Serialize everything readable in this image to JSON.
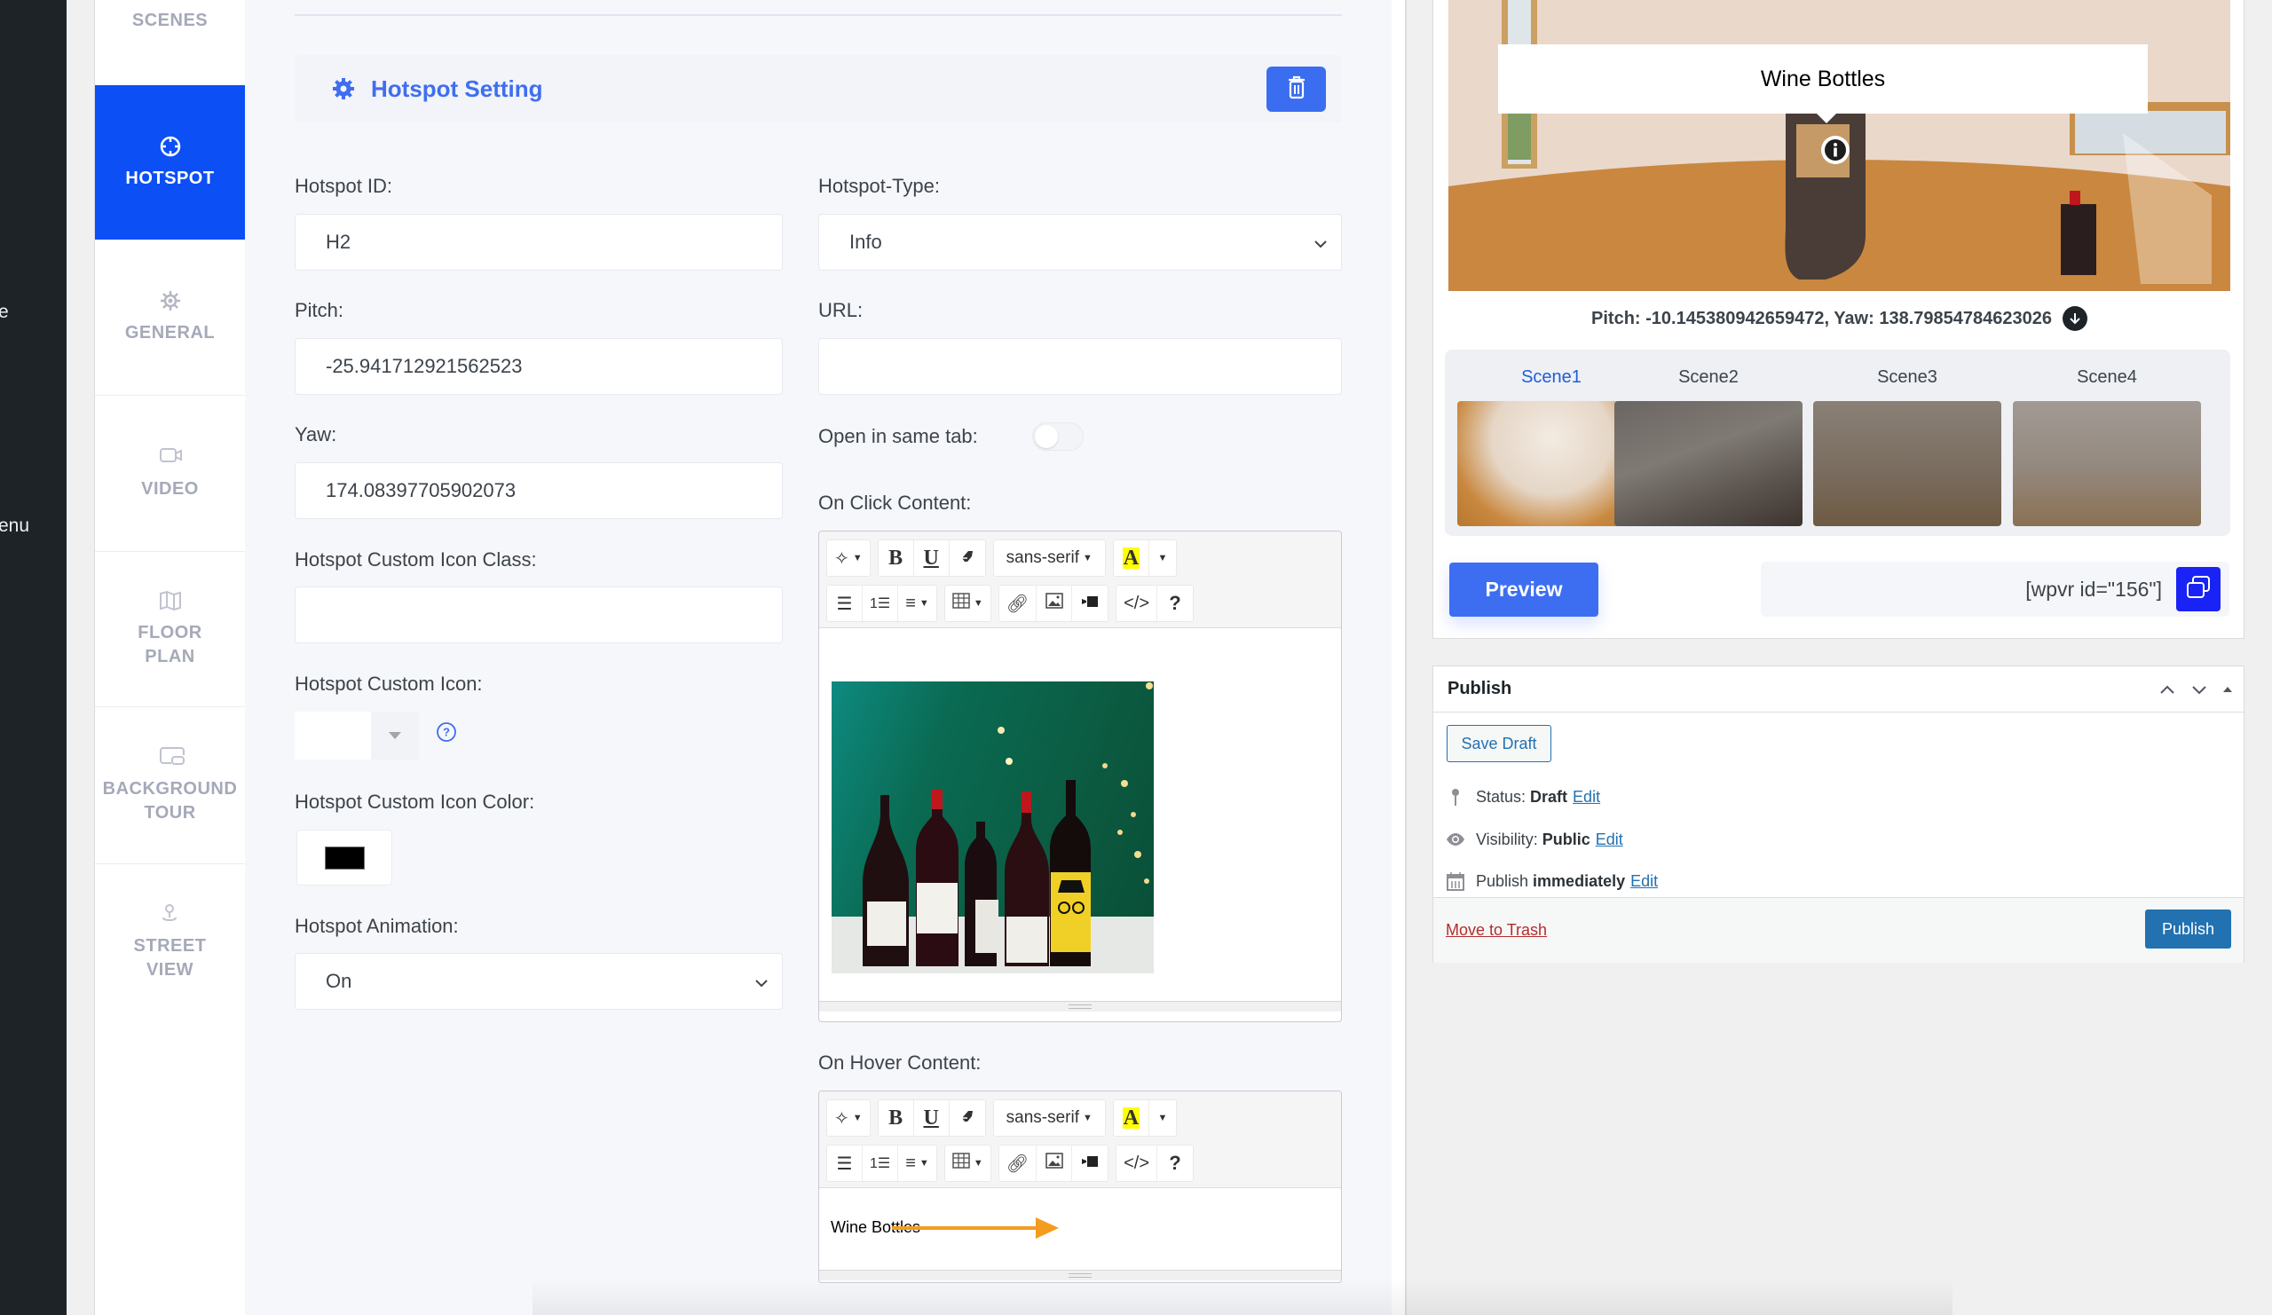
{
  "admin_menu": {
    "fragments": [
      "e",
      "enu"
    ]
  },
  "tabs": [
    {
      "label": "SCENES",
      "icon": "scenes-icon",
      "active": false
    },
    {
      "label": "HOTSPOT",
      "icon": "crosshair-icon",
      "active": true
    },
    {
      "label": "GENERAL",
      "icon": "gear-icon",
      "active": false
    },
    {
      "label": "VIDEO",
      "icon": "video-camera-icon",
      "active": false
    },
    {
      "label": "FLOOR PLAN",
      "icon": "map-icon",
      "active": false
    },
    {
      "label": "BACKGROUND TOUR",
      "icon": "background-tour-icon",
      "active": false
    },
    {
      "label": "STREET VIEW",
      "icon": "street-view-icon",
      "active": false
    }
  ],
  "hotspot": {
    "section_title": "Hotspot Setting",
    "delete_icon": "trash-icon",
    "fields": {
      "id": {
        "label": "Hotspot ID:",
        "value": "H2"
      },
      "type": {
        "label": "Hotspot-Type:",
        "value": "Info"
      },
      "pitch": {
        "label": "Pitch:",
        "value": "-25.941712921562523"
      },
      "url": {
        "label": "URL:",
        "value": ""
      },
      "yaw": {
        "label": "Yaw:",
        "value": "174.08397705902073"
      },
      "open_same_tab": {
        "label": "Open in same tab:",
        "value": false
      },
      "custom_icon_class": {
        "label": "Hotspot Custom Icon Class:",
        "value": ""
      },
      "custom_icon": {
        "label": "Hotspot Custom Icon:",
        "value": ""
      },
      "custom_icon_color": {
        "label": "Hotspot Custom Icon Color:",
        "value": "#000000"
      },
      "animation": {
        "label": "Hotspot Animation:",
        "value": "On"
      }
    },
    "on_click": {
      "label": "On Click Content:",
      "font": "sans-serif",
      "image_alt": "Wine bottles on green background"
    },
    "on_hover": {
      "label": "On Hover Content:",
      "font": "sans-serif",
      "text": "Wine Bottles"
    }
  },
  "preview": {
    "tooltip": "Wine Bottles",
    "coords": "Pitch: -10.145380942659472, Yaw: 138.79854784623026",
    "scenes": [
      {
        "name": "Scene1",
        "active": true
      },
      {
        "name": "Scene2",
        "active": false
      },
      {
        "name": "Scene3",
        "active": false
      },
      {
        "name": "Scene4",
        "active": false
      }
    ],
    "preview_button": "Preview",
    "shortcode": "[wpvr id=\"156\"]"
  },
  "publish": {
    "title": "Publish",
    "save_draft": "Save Draft",
    "status_label": "Status:",
    "status_value": "Draft",
    "visibility_label": "Visibility:",
    "visibility_value": "Public",
    "schedule_label": "Publish",
    "schedule_value": "immediately",
    "edit_link": "Edit",
    "trash": "Move to Trash",
    "publish_button": "Publish"
  },
  "colors": {
    "accent": "#0b4ff5",
    "header_blue": "#3f6ef0",
    "copy_button": "#1a23f5",
    "wp_primary": "#2271b1",
    "danger": "#b32d2e",
    "annotation_arrow": "#f39c1f"
  }
}
